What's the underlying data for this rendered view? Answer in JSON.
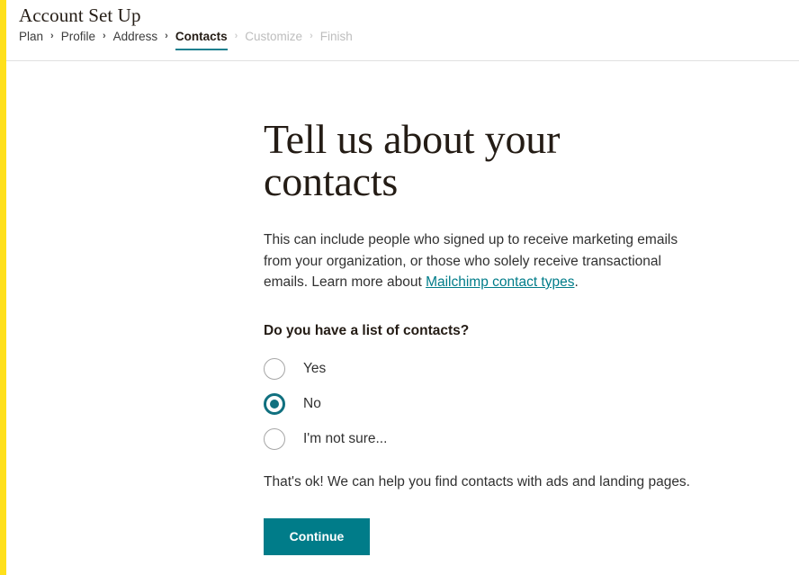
{
  "brand": {
    "stripe_color": "#ffe01b",
    "accent_teal": "#007c89",
    "active_underline": "#1a7f8e"
  },
  "header": {
    "title": "Account Set Up",
    "breadcrumb": {
      "separator": "›",
      "steps": [
        {
          "label": "Plan",
          "state": "done"
        },
        {
          "label": "Profile",
          "state": "done"
        },
        {
          "label": "Address",
          "state": "done"
        },
        {
          "label": "Contacts",
          "state": "active"
        },
        {
          "label": "Customize",
          "state": "upcoming"
        },
        {
          "label": "Finish",
          "state": "upcoming"
        }
      ]
    }
  },
  "main": {
    "headline": "Tell us about your contacts",
    "lede": {
      "before_link": "This can include people who signed up to receive marketing emails from your organization, or those who solely receive transactional emails. Learn more about ",
      "link_text": "Mailchimp contact types",
      "after_link": "."
    },
    "question": "Do you have a list of contacts?",
    "options": [
      {
        "label": "Yes",
        "selected": false
      },
      {
        "label": "No",
        "selected": true
      },
      {
        "label": "I'm not sure...",
        "selected": false
      }
    ],
    "reassurance": "That's ok! We can help you find contacts with ads and landing pages.",
    "continue_label": "Continue"
  }
}
